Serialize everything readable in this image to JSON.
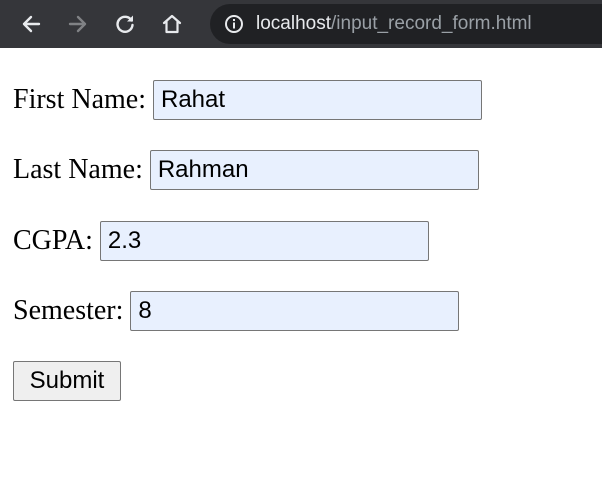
{
  "browser": {
    "url_host": "localhost",
    "url_path": "/input_record_form.html"
  },
  "form": {
    "first_name_label": "First Name:",
    "first_name_value": "Rahat",
    "last_name_label": "Last Name:",
    "last_name_value": "Rahman",
    "cgpa_label": "CGPA:",
    "cgpa_value": "2.3",
    "semester_label": "Semester:",
    "semester_value": "8",
    "submit_label": "Submit"
  },
  "colors": {
    "toolbar_bg": "#35363a",
    "omnibox_bg": "#202124",
    "autofill_bg": "#e8f0fe"
  },
  "icons": {
    "back": "back-arrow-icon",
    "forward": "forward-arrow-icon",
    "reload": "reload-icon",
    "home": "home-icon",
    "site_info": "info-icon"
  }
}
